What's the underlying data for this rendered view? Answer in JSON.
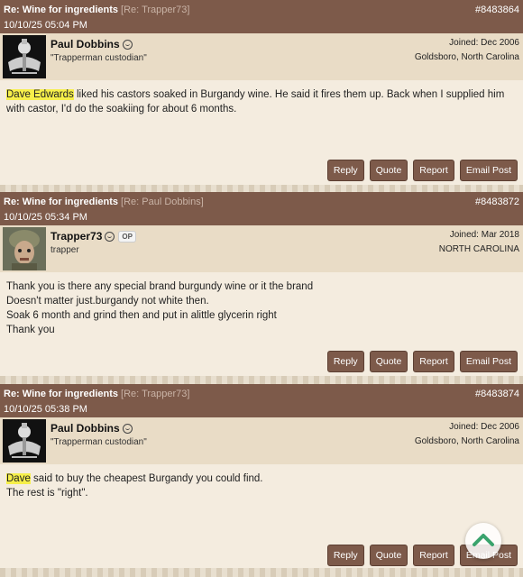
{
  "posts": [
    {
      "title": "Re: Wine for ingredients",
      "reply_to": "[Re: Trapper73]",
      "post_id": "#8483864",
      "datetime": "10/10/25 05:04 PM",
      "author": "Paul Dobbins",
      "author_title": "\"Trapperman custodian\"",
      "joined": "Joined: Dec 2006",
      "location": "Goldsboro, North Carolina",
      "body_highlight": "Dave Edwards",
      "body_rest": " liked his castors soaked in Burgandy wine. He said it fires them up. Back when I supplied him with castor, I'd do the soakiing for about 6 months."
    },
    {
      "title": "Re: Wine for ingredients",
      "reply_to": "[Re: Paul Dobbins]",
      "post_id": "#8483872",
      "datetime": "10/10/25 05:34 PM",
      "author": "Trapper73",
      "op_badge": "OP",
      "author_title": "trapper",
      "joined": "Joined: Mar 2018",
      "location": "NORTH CAROLINA",
      "body_lines": [
        "Thank you is there any special brand burgundy wine or it the brand",
        "Doesn't matter just.burgandy not white then.",
        "Soak 6 month and grind then and put in alittle glycerin right",
        "Thank you"
      ]
    },
    {
      "title": "Re: Wine for ingredients",
      "reply_to": "[Re: Trapper73]",
      "post_id": "#8483874",
      "datetime": "10/10/25 05:38 PM",
      "author": "Paul Dobbins",
      "author_title": "\"Trapperman custodian\"",
      "joined": "Joined: Dec 2006",
      "location": "Goldsboro, North Carolina",
      "body_highlight": "Dave",
      "body_rest": " said to buy the cheapest Burgandy you could find.",
      "body_line2": "The rest is \"right\"."
    }
  ],
  "buttons": {
    "reply": "Reply",
    "quote": "Quote",
    "report": "Report",
    "email": "Email Post"
  },
  "icons": {
    "scroll_top": "chevron-up-icon",
    "online": "smiley-status-icon"
  },
  "colors": {
    "header_bar": "#7d5a4a",
    "author_bg": "#e9dcc6",
    "body_bg": "#f4ecdf",
    "highlight": "#f6ef4a",
    "scroll_top_arrow": "#3aa36d"
  }
}
